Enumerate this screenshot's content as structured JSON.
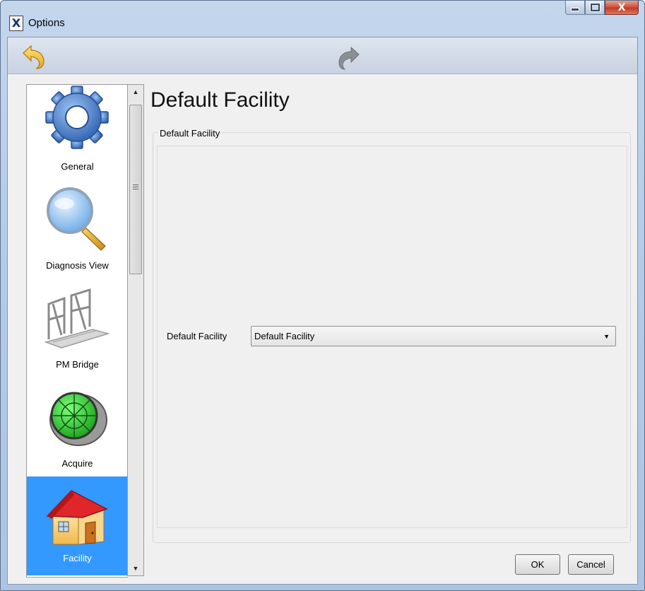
{
  "window": {
    "title": "Options",
    "app_icon_glyph": "X",
    "close_glyph": "X"
  },
  "toolbar": {
    "back_icon": "back-arrow-icon",
    "forward_icon": "forward-arrow-icon"
  },
  "nav": {
    "items": [
      {
        "label": "General",
        "icon": "gear-icon"
      },
      {
        "label": "Diagnosis View",
        "icon": "magnifier-icon"
      },
      {
        "label": "PM Bridge",
        "icon": "bridge-icon"
      },
      {
        "label": "Acquire",
        "icon": "target-icon"
      },
      {
        "label": "Facility",
        "icon": "house-icon",
        "selected": true
      }
    ],
    "selected_color": "#3399ff"
  },
  "scrollbar": {
    "up_glyph": "▲",
    "down_glyph": "▼"
  },
  "page": {
    "title": "Default Facility",
    "group_label": "Default Facility",
    "field_label": "Default Facility",
    "field_value": "Default Facility",
    "field_arrow": "▼"
  },
  "buttons": {
    "ok": "OK",
    "cancel": "Cancel"
  }
}
